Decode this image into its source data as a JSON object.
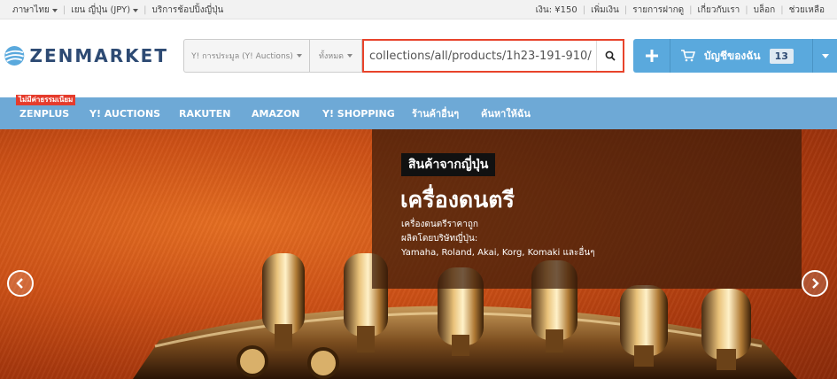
{
  "topbar": {
    "language": "ภาษาไทย",
    "currency": "เยน ญี่ปุ่น (JPY)",
    "shipping_service": "บริการช้อปปิ้งญี่ปุ่น",
    "balance": "เงิน: ¥150",
    "add_funds": "เพิ่มเงิน",
    "deposit_list": "รายการฝากดู",
    "about": "เกี่ยวกับเรา",
    "blog": "บล็อก",
    "help": "ช่วยเหลือ"
  },
  "logo": {
    "text": "ZENMARKET"
  },
  "search": {
    "category": "Y! การประมูล (Y! Auctions)",
    "scope": "ทั้งหมด",
    "value": "/collections/all/products/1h23-191-910",
    "button_icon": "search-icon"
  },
  "cart": {
    "plus_icon": "plus-icon",
    "cart_icon": "shopping-cart-icon",
    "label": "บัญชีของฉัน",
    "count": "13"
  },
  "nav": {
    "badge": "ไม่มีค่าธรรมเนียม",
    "items": [
      "ZENPLUS",
      "Y! AUCTIONS",
      "RAKUTEN",
      "AMAZON",
      "Y! SHOPPING",
      "ร้านค้าอื่นๆ",
      "ค้นหาให้ฉัน"
    ]
  },
  "hero": {
    "tag": "สินค้าจากญี่ปุ่น",
    "title": "เครื่องดนตรี",
    "desc_line1": "เครื่องดนตรีราคาถูก",
    "desc_line2": "ผลิตโดยบริษัทญี่ปุ่น:",
    "desc_line3": "Yamaha, Roland, Akai, Korg, Komaki และอื่นๆ"
  },
  "colors": {
    "brand_blue": "#2d4a73",
    "accent_blue": "#5aa9dd",
    "nav_blue": "#6ea9d6",
    "highlight_red": "#e8432b",
    "badge_red": "#e53b2c"
  }
}
